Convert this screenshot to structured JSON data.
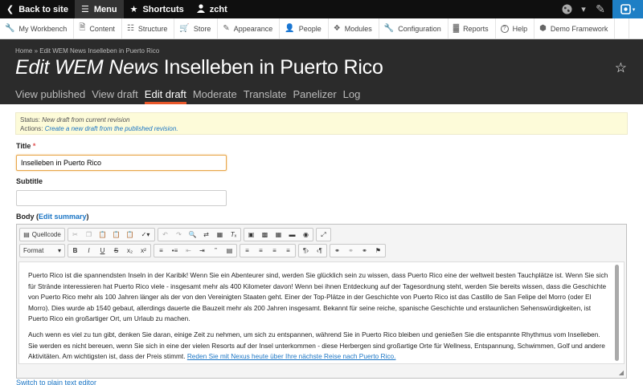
{
  "topbar": {
    "back": "Back to site",
    "menu": "Menu",
    "shortcuts": "Shortcuts",
    "user": "zcht"
  },
  "tray": [
    {
      "label": "My Workbench",
      "icon": "wrench-icon"
    },
    {
      "label": "Content",
      "icon": "document-icon"
    },
    {
      "label": "Structure",
      "icon": "structure-icon"
    },
    {
      "label": "Store",
      "icon": "cart-icon"
    },
    {
      "label": "Appearance",
      "icon": "paintbrush-icon"
    },
    {
      "label": "People",
      "icon": "person-icon"
    },
    {
      "label": "Modules",
      "icon": "puzzle-icon"
    },
    {
      "label": "Configuration",
      "icon": "wrench-icon"
    },
    {
      "label": "Reports",
      "icon": "chart-icon"
    },
    {
      "label": "Help",
      "icon": "help-icon"
    },
    {
      "label": "Demo Framework",
      "icon": "cube-icon"
    }
  ],
  "header": {
    "breadcrumb": "Home » Edit WEM News Inselleben in Puerto Rico",
    "title_italic": "Edit WEM News",
    "title_rest": " Inselleben in Puerto Rico",
    "tabs": [
      "View published",
      "View draft",
      "Edit draft",
      "Moderate",
      "Translate",
      "Panelizer",
      "Log"
    ],
    "active_tab": "Edit draft"
  },
  "status": {
    "status_label": "Status: ",
    "status_value": "New draft from current revision",
    "actions_label": "Actions: ",
    "actions_link": "Create a new draft from the published revision."
  },
  "form": {
    "title_label": "Title",
    "required_mark": "*",
    "title_value": "Inselleben in Puerto Rico",
    "subtitle_label": "Subtitle",
    "subtitle_value": "",
    "body_label": "Body",
    "body_paren_open": " (",
    "edit_summary": "Edit summary",
    "body_paren_close": ")",
    "switch_editor": "Switch to plain text editor"
  },
  "editor": {
    "source_label": "Quellcode",
    "format_label": "Format",
    "paragraph1": "Puerto Rico ist die spannendsten Inseln in der Karibik! Wenn Sie ein Abenteurer sind, werden Sie glücklich sein zu wissen, dass Puerto Rico eine der weltweit besten Tauchplätze ist. Wenn Sie sich für Strände interessieren hat Puerto Rico viele - insgesamt mehr als 400 Kilometer davon! Wenn bei ihnen Entdeckung auf der Tagesordnung steht, werden Sie bereits wissen, dass die Geschichte von Puerto Rico mehr als 100 Jahren länger als der von den Vereinigten Staaten geht. Einer der Top-Plätze in der Geschichte von Puerto Rico ist das Castillo de San Felipe del Morro (oder El Morro). Dies wurde ab 1540 gebaut, allerdings dauerte die Bauzeit mehr als 200 Jahren insgesamt. Bekannt für seine reiche, spanische Geschichte und erstaunlichen Sehenswürdigkeiten, ist Puerto Rico ein großartiger Ort, um Urlaub zu machen.",
    "paragraph2": "Auch wenn es viel zu tun gibt, denken Sie daran, einige Zeit zu nehmen, um sich zu entspannen, während Sie in Puerto Rico bleiben und genießen Sie die entspannte Rhythmus vom Inselleben. Sie werden es nicht bereuen, wenn Sie sich in eine der vielen Resorts auf der Insel unterkommen - diese Herbergen sind großartige Orte für Wellness, Entspannung, Schwimmen, Golf und andere Aktivitäten. Am wichtigsten ist, dass der Preis stimmt. ",
    "paragraph2_link": "Reden Sie mit Nexus heute über Ihre nächste Reise nach Puerto Rico."
  },
  "colors": {
    "accent_tab": "#e8572a",
    "link": "#1a75c5",
    "topbar": "#0f0f0f",
    "header": "#2b2b2b",
    "status_bg": "#fdfbd9"
  }
}
